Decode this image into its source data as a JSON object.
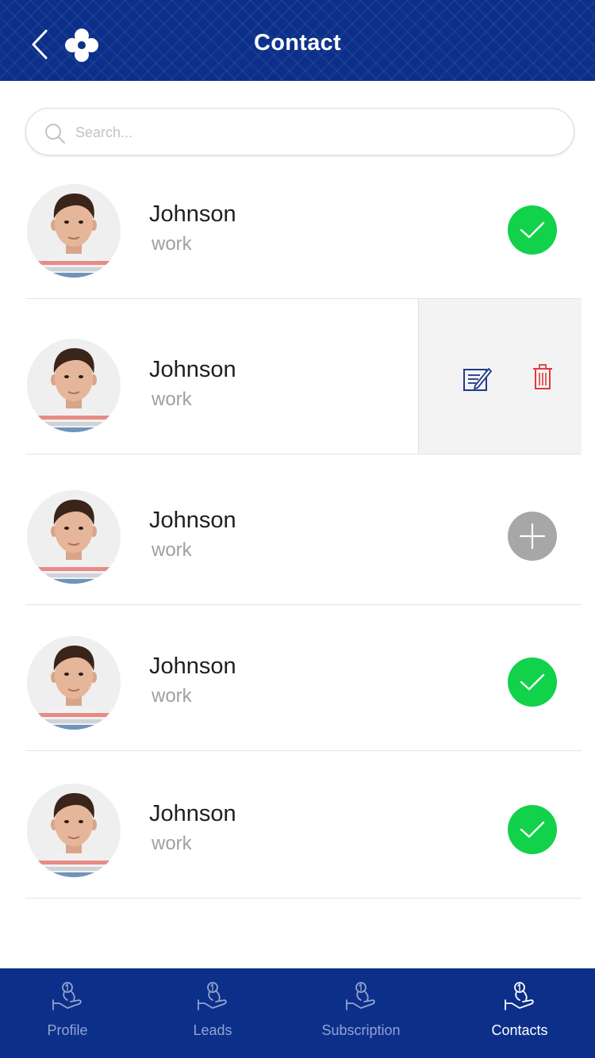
{
  "header": {
    "title": "Contact",
    "back_icon": "chevron-left-icon",
    "logo_icon": "clover-logo-icon",
    "background_color": "#0c2f8a"
  },
  "search": {
    "placeholder": "Search...",
    "value": "",
    "icon": "search-icon"
  },
  "contacts": [
    {
      "name": "Johnson",
      "subtitle": "work",
      "status": "check"
    },
    {
      "name": "Johnson",
      "subtitle": "work",
      "status": "actions"
    },
    {
      "name": "Johnson",
      "subtitle": "work",
      "status": "add"
    },
    {
      "name": "Johnson",
      "subtitle": "work",
      "status": "check"
    },
    {
      "name": "Johnson",
      "subtitle": "work",
      "status": "check"
    }
  ],
  "row_actions": {
    "edit_icon": "edit-icon",
    "delete_icon": "trash-icon"
  },
  "colors": {
    "check_green": "#11d24a",
    "add_gray": "#a7a7a7",
    "edit_blue": "#1e3a8c",
    "delete_red": "#e03a3a"
  },
  "bottom_nav": {
    "items": [
      {
        "label": "Profile",
        "icon": "hand-icon",
        "active": false
      },
      {
        "label": "Leads",
        "icon": "hand-icon",
        "active": false
      },
      {
        "label": "Subscription",
        "icon": "hand-icon",
        "active": false
      },
      {
        "label": "Contacts",
        "icon": "hand-icon",
        "active": true
      }
    ]
  }
}
